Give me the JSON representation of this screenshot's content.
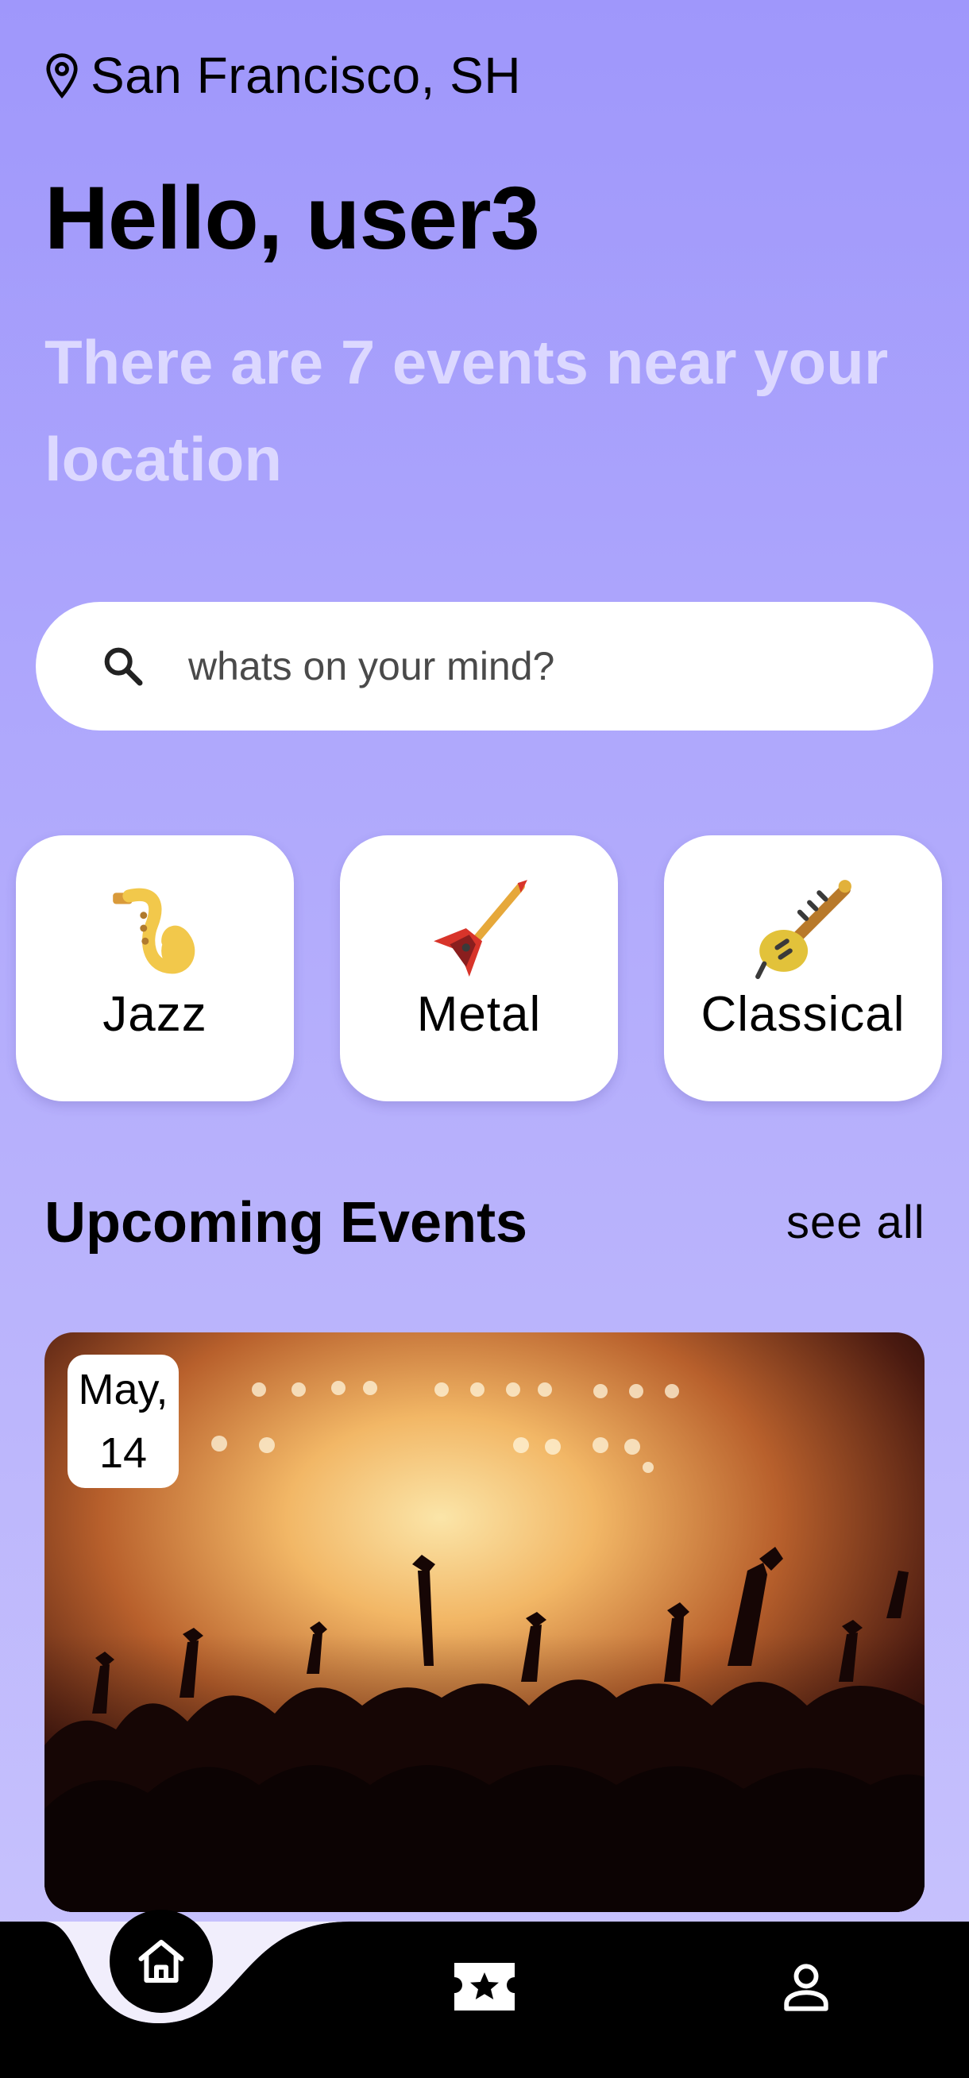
{
  "location": {
    "text": "San Francisco, SH",
    "icon": "map-pin-icon"
  },
  "greeting": "Hello, user3",
  "subtitle": "There are 7 events near your location",
  "search": {
    "placeholder": "whats on your mind?",
    "icon": "search-icon"
  },
  "categories": [
    {
      "label": "Jazz",
      "icon": "saxophone-icon"
    },
    {
      "label": "Metal",
      "icon": "electric-guitar-icon"
    },
    {
      "label": "Classical",
      "icon": "sitar-icon"
    }
  ],
  "upcoming": {
    "title": "Upcoming Events",
    "see_all": "see all"
  },
  "event": {
    "date_month": "May,",
    "date_day": "14",
    "image": "concert-crowd-photo"
  },
  "nav": {
    "items": [
      "home-icon",
      "ticket-star-icon",
      "profile-icon"
    ],
    "active": "home-icon"
  },
  "colors": {
    "bg_top": "#9f97fb",
    "bg_bottom": "#c9c4fd",
    "subtitle": "#dcd8ff",
    "nav": "#000000"
  }
}
